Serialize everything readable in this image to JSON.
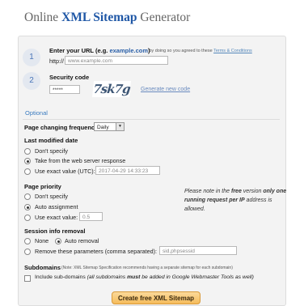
{
  "header": {
    "title_pre": "Online",
    "title_brand": "XML Sitemap",
    "title_post": "Generator"
  },
  "url_step": {
    "number": "1",
    "label": "Enter your URL (e.g.",
    "example_domain": "example.com",
    "label_close": ")",
    "terms_prefix": "- by doing so you agreed to these",
    "terms_link": "Terms & Conditions",
    "protocol": "http://",
    "placeholder": "www.example.com"
  },
  "security_step": {
    "number": "2",
    "label": "Security code",
    "field_value": "*****",
    "captcha_text": "7sk7g",
    "generate_link": "Generate new code"
  },
  "optional": {
    "heading": "Optional",
    "page_changing_frequency": {
      "label": "Page changing frequency",
      "selected": "Daily"
    },
    "last_modified": {
      "label": "Last modified date",
      "options": [
        "Don't specify",
        "Take from the web server response",
        "Use exact value (UTC):"
      ],
      "exact_value": "2017-04-29 14:33:23"
    },
    "page_priority": {
      "label": "Page priority",
      "options": [
        "Don't specify",
        "Auto assignment",
        "Use exact value:"
      ],
      "exact_value": "0.5"
    },
    "session_info_removal": {
      "label": "Session info removal",
      "option_none": "None",
      "option_auto": "Auto removal",
      "option_remove": "Remove these parameters (comma separated):",
      "params_value": "sid,phpsessid"
    },
    "subdomains": {
      "label": "Subdomains",
      "note": "(Note: XML Sitemap Specification recommends having a separate sitemap for each subdomain)",
      "checkbox_label_pre": "Include sub-domains",
      "checkbox_label_rest_a": "(all subdomains",
      "checkbox_label_must": "must",
      "checkbox_label_rest_b": "be added in Google Webmaster Tools as well)"
    }
  },
  "notice": {
    "part1": "Please note in the",
    "free": "free",
    "part2": "version",
    "only_one": "only one running request per IP",
    "part3": "address is allowed."
  },
  "submit_label": "Create free XML Sitemap"
}
